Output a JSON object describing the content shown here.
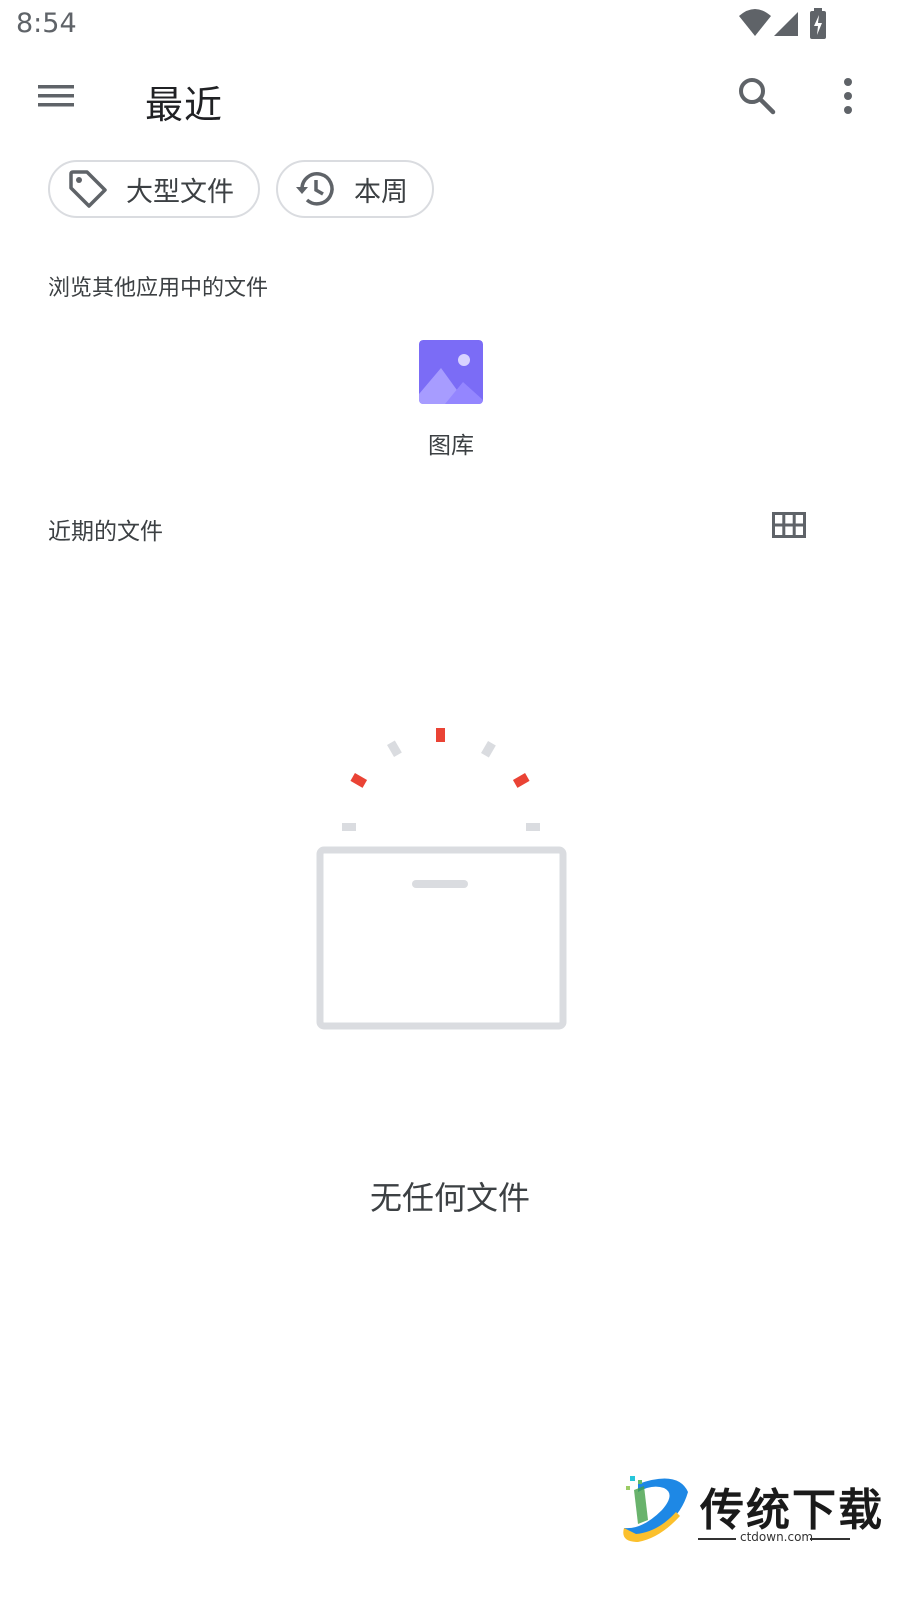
{
  "status_bar": {
    "time": "8:54",
    "icons": [
      "wifi-icon",
      "signal-icon",
      "battery-charging-icon"
    ]
  },
  "app_bar": {
    "title": "最近",
    "icons": [
      "menu-icon",
      "search-icon",
      "more-vert-icon"
    ]
  },
  "chips": [
    {
      "label": "大型文件",
      "icon": "label-tag-icon"
    },
    {
      "label": "本周",
      "icon": "history-icon"
    }
  ],
  "browse_section": {
    "heading": "浏览其他应用中的文件",
    "apps": [
      {
        "label": "图库",
        "icon": "gallery-icon"
      }
    ]
  },
  "recent_section": {
    "heading": "近期的文件",
    "view_toggle_icon": "grid-view-icon"
  },
  "empty_state": {
    "message": "无任何文件",
    "illustration": "empty-box-illustration"
  },
  "watermark": {
    "title": "传统下载",
    "subtitle": "ctdown.com"
  },
  "colors": {
    "accent_red": "#ea4335",
    "gallery_purple": "#7b6cf6",
    "border_gray": "#dadce0",
    "illustration_gray": "#dadce0"
  }
}
